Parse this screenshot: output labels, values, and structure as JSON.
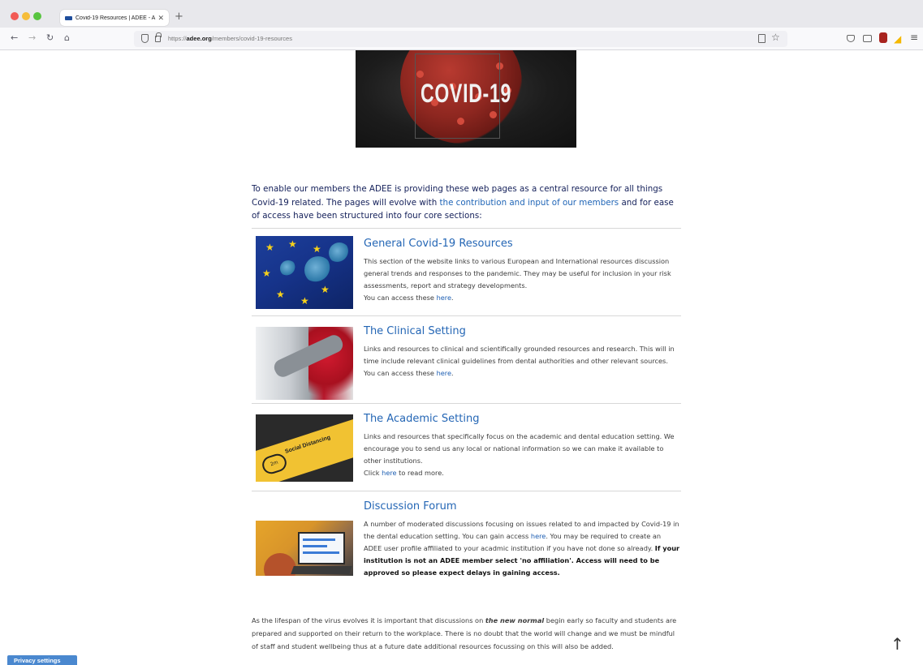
{
  "browser": {
    "tab_title": "Covid-19 Resources | ADEE - A",
    "tab_close": "✕",
    "new_tab": "+",
    "url_prefix": "https://",
    "url_domain": "adee.org",
    "url_path": "/members/covid-19-resources"
  },
  "hero": {
    "image_text": "COVID-19"
  },
  "intro": {
    "text_before": "To enable our members the ADEE is providing these web pages as a central resource for all things Covid-19 related. The pages will evolve with ",
    "link": "the contribution and input of our members",
    "text_after": " and for ease of access have been structured into four core sections:"
  },
  "sections": [
    {
      "title": "General Covid-19 Resources",
      "body": "This section of the website links to various European and International resources discussion general trends and responses to the pandemic. They may be useful for inclusion in your risk assessments, report and strategy developments.",
      "access_prefix": "You can access these ",
      "access_link": "here",
      "access_suffix": "."
    },
    {
      "title": "The Clinical Setting",
      "body": "Links and resources to clinical and scientifically grounded resources and research. This will in time include relevant clinical guidelines from dental authorities and other relevant sources.",
      "access_prefix": "You can access these ",
      "access_link": "here",
      "access_suffix": "."
    },
    {
      "title": "The Academic Setting",
      "body": "Links and resources that specifically focus on the academic and dental education setting. We encourage you to send us any local or national information so we can make it available to other institutions.",
      "access_prefix": "Click ",
      "access_link": "here",
      "access_suffix": " to read more.",
      "image_label": "Social Distancing",
      "image_sign": "2m"
    },
    {
      "title": "Discussion Forum",
      "body_before": "A number of moderated discussions focusing on issues related to and impacted by Covid-19 in the dental education setting. You can gain access ",
      "access_link": "here",
      "body_after": ". You may be required to create an ADEE user profile affiliated to your acadmic institution if you have not done so already. ",
      "bold_note": "If your institution is not an ADEE member select 'no affiliation'. Access will need to be approved so please expect delays in gaining access."
    }
  ],
  "closing": {
    "text_before": "As the lifespan of the virus evolves it is important that discussions on ",
    "emphasis": "the new normal",
    "text_after": " begin early so faculty and students are prepared and supported on their return to the workplace. There is no doubt that the world will change and we must be mindful of staff and student wellbeing thus at a future date additional resources focussing on this will also be added."
  },
  "privacy_button": "Privacy settings",
  "scroll_top_icon": "↑",
  "colors": {
    "link": "#2166b7",
    "heading": "#2466b5",
    "intro_text": "#14205a",
    "privacy_bg": "#4a88cf"
  }
}
